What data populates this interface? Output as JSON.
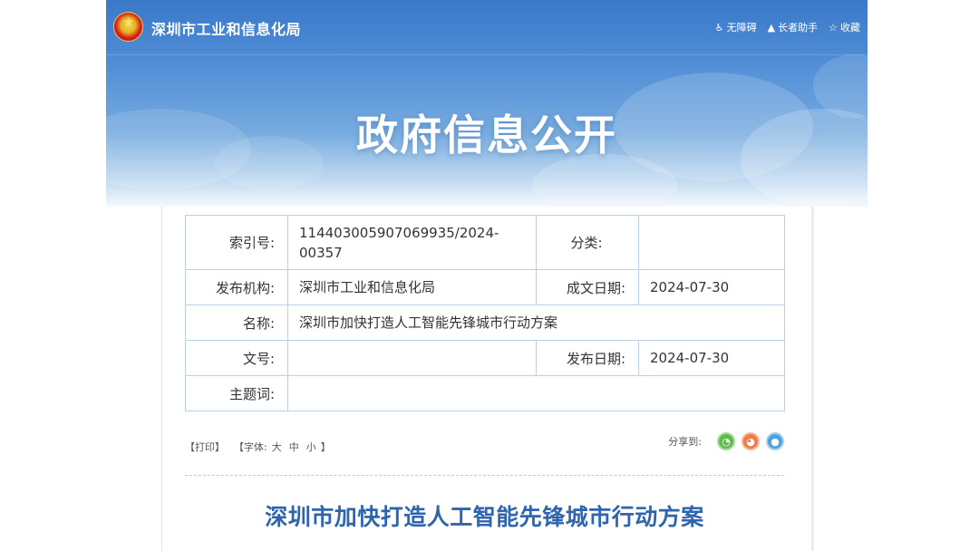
{
  "header": {
    "site_name": "深圳市工业和信息化局",
    "banner_title": "政府信息公开",
    "tools": [
      {
        "label": "无障碍",
        "icon": "accessibility-icon",
        "glyph": "♿"
      },
      {
        "label": "长者助手",
        "icon": "elder-assist-icon",
        "glyph": "▲"
      },
      {
        "label": "收藏",
        "icon": "star-icon",
        "glyph": "☆"
      }
    ]
  },
  "meta": {
    "index_no_label": "索引号:",
    "index_no_value": "11440300590706993​5/2024-00357",
    "category_label": "分类:",
    "category_value": "",
    "publisher_label": "发布机构:",
    "publisher_value": "深圳市工业和信息化局",
    "written_date_label": "成文日期:",
    "written_date_value": "2024-07-30",
    "name_label": "名称:",
    "name_value": "深圳市加快打造人工智能先锋城市行动方案",
    "doc_no_label": "文号:",
    "doc_no_value": "",
    "publish_date_label": "发布日期:",
    "publish_date_value": "2024-07-30",
    "keywords_label": "主题词:",
    "keywords_value": ""
  },
  "toolbar": {
    "print": "【打印】",
    "font_prefix": "【字体:",
    "font_large": "大",
    "font_medium": "中",
    "font_small": "小",
    "font_suffix": "】",
    "share_label": "分享到:",
    "share_buttons": [
      {
        "name": "wechat",
        "glyph": "◔"
      },
      {
        "name": "weibo",
        "glyph": "◕"
      },
      {
        "name": "qq",
        "glyph": "●"
      }
    ]
  },
  "document": {
    "title": "深圳市加快打造人工智能先锋城市行动方案"
  },
  "colors": {
    "banner_top": "#3a79c9",
    "title_blue": "#2f65ad",
    "table_border": "#b9d2ea"
  }
}
